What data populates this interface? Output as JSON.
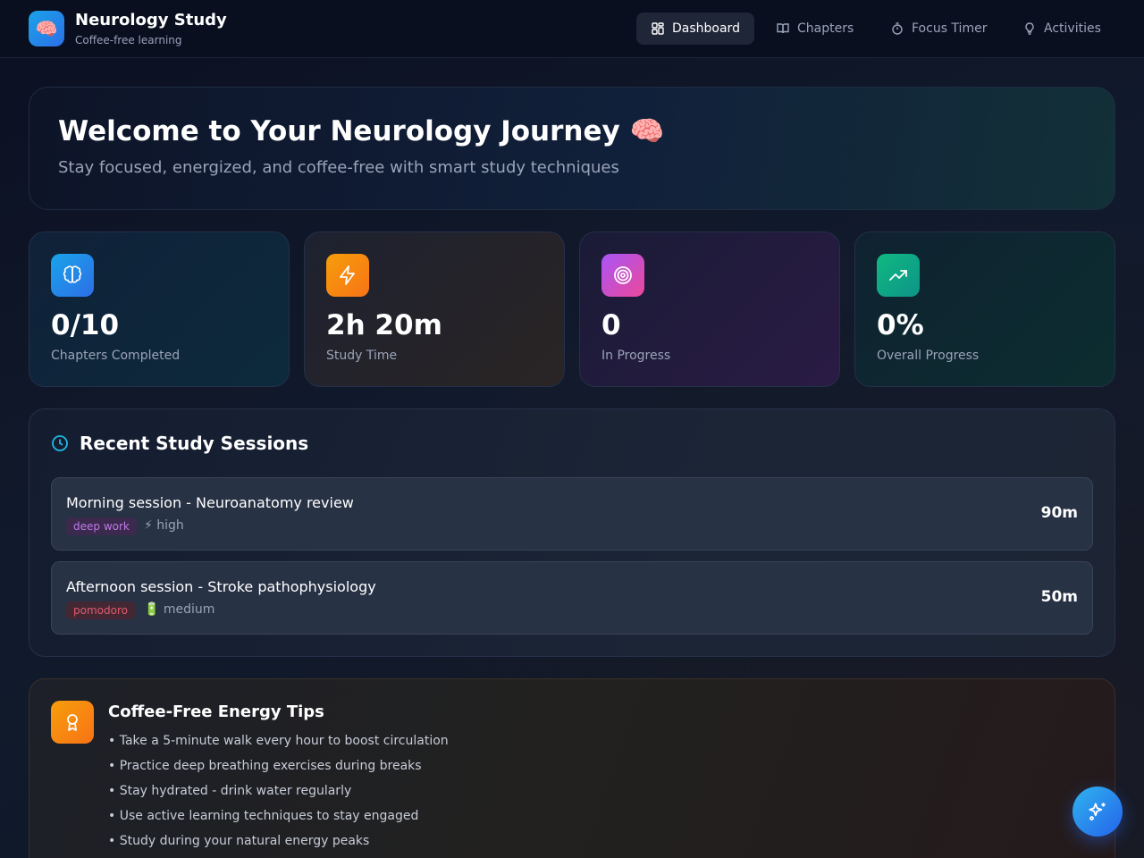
{
  "brand": {
    "logo": "brain-emoji",
    "title": "Neurology Study",
    "subtitle": "Coffee-free learning"
  },
  "nav": [
    {
      "label": "Dashboard",
      "icon": "grid-icon",
      "active": true
    },
    {
      "label": "Chapters",
      "icon": "book-icon",
      "active": false
    },
    {
      "label": "Focus Timer",
      "icon": "timer-icon",
      "active": false
    },
    {
      "label": "Activities",
      "icon": "lightbulb-icon",
      "active": false
    }
  ],
  "hero": {
    "title": "Welcome to Your Neurology Journey 🧠",
    "subtitle": "Stay focused, energized, and coffee-free with smart study techniques"
  },
  "stats": [
    {
      "value": "0/10",
      "label": "Chapters Completed",
      "icon": "brain-icon",
      "color": "#2b8ef0"
    },
    {
      "value": "2h 20m",
      "label": "Study Time",
      "icon": "lightning-icon",
      "color": "#f59e0b"
    },
    {
      "value": "0",
      "label": "In Progress",
      "icon": "target-icon",
      "color": "#c044d8"
    },
    {
      "value": "0%",
      "label": "Overall Progress",
      "icon": "trending-up-icon",
      "color": "#10b981"
    }
  ],
  "sessions": {
    "title": "Recent Study Sessions",
    "items": [
      {
        "name": "Morning session - Neuroanatomy review",
        "tag": "deep work",
        "energy": "⚡ high",
        "duration": "90m"
      },
      {
        "name": "Afternoon session - Stroke pathophysiology",
        "tag": "pomodoro",
        "energy": "🔋 medium",
        "duration": "50m"
      }
    ]
  },
  "tips": {
    "title": "Coffee-Free Energy Tips",
    "items": [
      "• Take a 5-minute walk every hour to boost circulation",
      "• Practice deep breathing exercises during breaks",
      "• Stay hydrated - drink water regularly",
      "• Use active learning techniques to stay engaged",
      "• Study during your natural energy peaks"
    ]
  },
  "colors": {
    "accent": "#2b8ef0",
    "background": "#0b1022"
  }
}
